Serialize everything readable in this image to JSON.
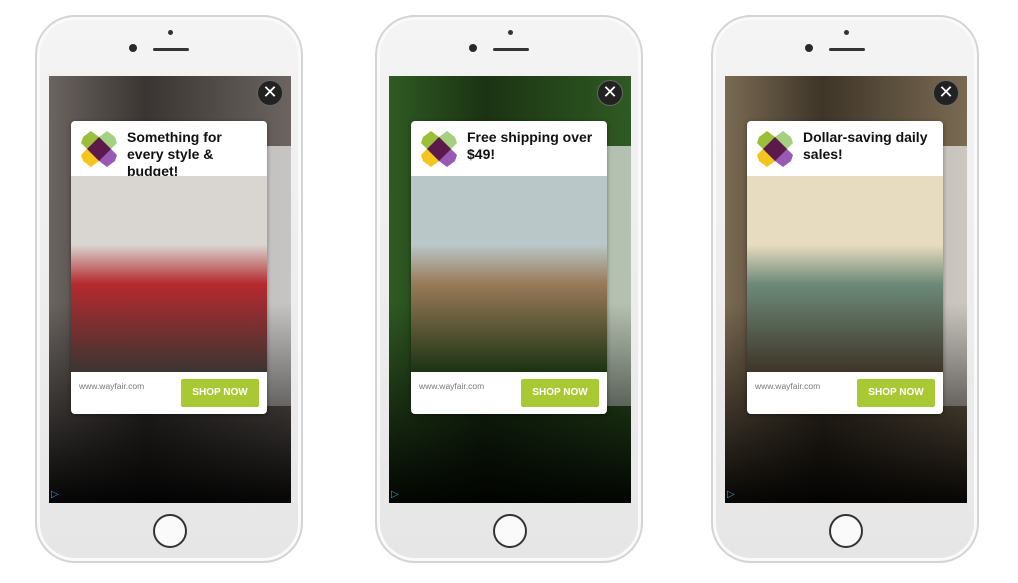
{
  "ads": [
    {
      "headline": "Something for every style & budget!",
      "url": "www.wayfair.com",
      "cta": "SHOP NOW",
      "close_icon": "close-icon",
      "image": "red paisley bedroom",
      "bg": [
        "#6b6460",
        "#3a3532",
        "#d9d6d2",
        "#b52a2e"
      ]
    },
    {
      "headline": "Free shipping over $49!",
      "url": "www.wayfair.com",
      "cta": "SHOP NOW",
      "close_icon": "close-icon",
      "image": "hot tub on deck",
      "bg": [
        "#2f5a22",
        "#1b3313",
        "#b9c7c9",
        "#9a7a58"
      ]
    },
    {
      "headline": "Dollar-saving daily sales!",
      "url": "www.wayfair.com",
      "cta": "SHOP NOW",
      "close_icon": "close-icon",
      "image": "green painted cabinet",
      "bg": [
        "#7a6a52",
        "#3e3528",
        "#e8dcc0",
        "#6d8a78"
      ]
    }
  ],
  "colors": {
    "cta": "#a9c934",
    "logo": [
      "#9cbf3a",
      "#a3d17f",
      "#f4c51c",
      "#9b59b6",
      "#5b1a4a"
    ]
  }
}
